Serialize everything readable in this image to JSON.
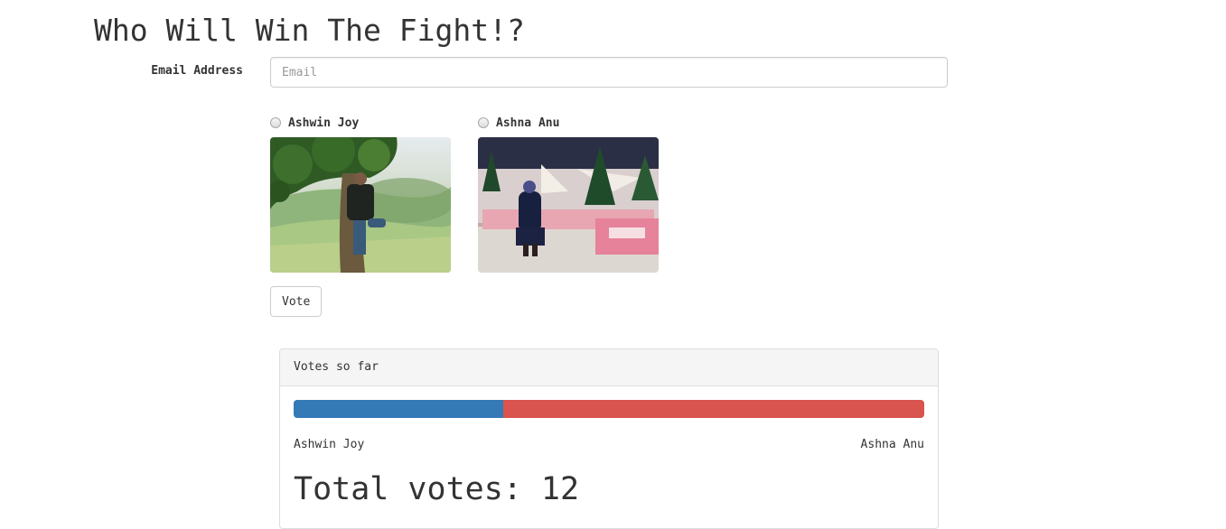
{
  "page": {
    "title": "Who Will Win The Fight!?"
  },
  "form": {
    "email_label": "Email Address",
    "email_placeholder": "Email",
    "email_value": ""
  },
  "candidates": [
    {
      "name": "Ashwin Joy",
      "photo": "photo of man standing by a tree"
    },
    {
      "name": "Ashna Anu",
      "photo": "photo of woman standing in front of a Christmas display"
    }
  ],
  "vote_button_label": "Vote",
  "results": {
    "heading": "Votes so far",
    "left_name": "Ashwin Joy",
    "right_name": "Ashna Anu",
    "left_share": 0.333,
    "right_share": 0.667,
    "total_label": "Total votes: 12"
  },
  "colors": {
    "bar_left": "#337ab7",
    "bar_right": "#d9534f"
  }
}
